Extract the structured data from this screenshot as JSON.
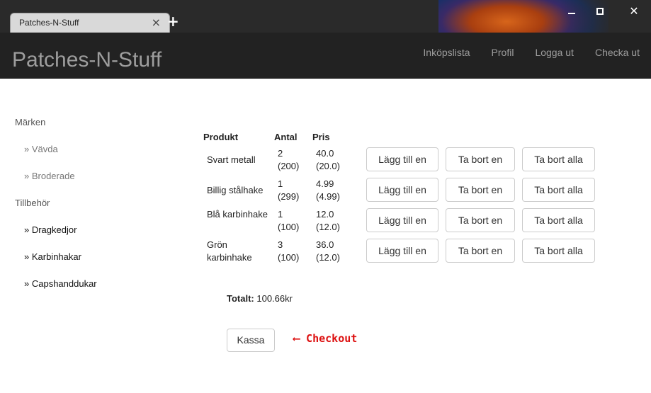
{
  "browser": {
    "tab_title": "Patches-N-Stuff",
    "tab_close_icon": "×",
    "new_tab_icon": "+",
    "close_icon": "✕"
  },
  "navbar": {
    "brand": "Patches-N-Stuff",
    "links": [
      "Inköpslista",
      "Profil",
      "Logga ut",
      "Checka ut"
    ]
  },
  "sidebar": {
    "categories": [
      {
        "label": "Märken",
        "items": [
          "» Vävda",
          "» Broderade"
        ]
      },
      {
        "label": "Tillbehör",
        "items": [
          "» Dragkedjor",
          "» Karbinhakar",
          "» Capshanddukar"
        ]
      }
    ]
  },
  "cart": {
    "headers": {
      "product": "Produkt",
      "qty": "Antal",
      "price": "Pris"
    },
    "rows": [
      {
        "product": "Svart metall",
        "qty": "2",
        "stock": "(200)",
        "price": "40.0",
        "unit_price": "(20.0)"
      },
      {
        "product": "Billig stålhake",
        "qty": "1",
        "stock": "(299)",
        "price": "4.99",
        "unit_price": "(4.99)"
      },
      {
        "product": "Blå karbinhake",
        "qty": "1",
        "stock": "(100)",
        "price": "12.0",
        "unit_price": "(12.0)"
      },
      {
        "product": "Grön karbinhake",
        "qty": "3",
        "stock": "(100)",
        "price": "36.0",
        "unit_price": "(12.0)"
      }
    ],
    "buttons": {
      "add": "Lägg till en",
      "remove": "Ta bort en",
      "remove_all": "Ta bort alla"
    },
    "total_label": "Totalt:",
    "total_value": "100.66kr",
    "checkout_button": "Kassa"
  },
  "annotation": {
    "text": "⟵ Checkout",
    "color": "#dd1111"
  }
}
